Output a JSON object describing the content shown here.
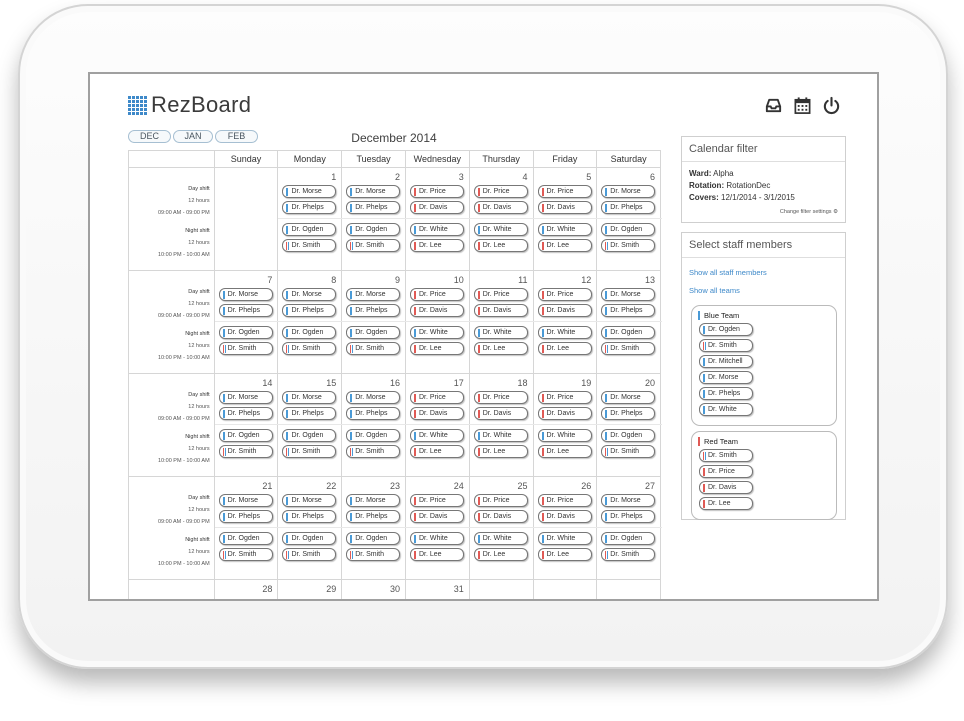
{
  "app": {
    "name": "RezBoard"
  },
  "header_icons": [
    "inbox-icon",
    "calendar-icon",
    "power-icon"
  ],
  "months": [
    "DEC",
    "JAN",
    "FEB"
  ],
  "calendar": {
    "title": "December 2014",
    "day_names": [
      "Sunday",
      "Monday",
      "Tuesday",
      "Wednesday",
      "Thursday",
      "Friday",
      "Saturday"
    ],
    "shift_labels": {
      "day": {
        "name": "Day shift",
        "hours": "12 hours",
        "time": "09:00 AM - 09:00 PM"
      },
      "night": {
        "name": "Night shift",
        "hours": "12 hours",
        "time": "10:00 PM - 10:00 AM"
      }
    },
    "weeks": [
      {
        "days": [
          {
            "num": "",
            "day": [],
            "night": []
          },
          {
            "num": "1",
            "day": [
              "Dr. Morse",
              "Dr. Phelps"
            ],
            "night": [
              "Dr. Ogden",
              "Dr. Smith"
            ]
          },
          {
            "num": "2",
            "day": [
              "Dr. Morse",
              "Dr. Phelps"
            ],
            "night": [
              "Dr. Ogden",
              "Dr. Smith"
            ]
          },
          {
            "num": "3",
            "day": [
              "Dr. Price",
              "Dr. Davis"
            ],
            "night": [
              "Dr. White",
              "Dr. Lee"
            ]
          },
          {
            "num": "4",
            "day": [
              "Dr. Price",
              "Dr. Davis"
            ],
            "night": [
              "Dr. White",
              "Dr. Lee"
            ]
          },
          {
            "num": "5",
            "day": [
              "Dr. Price",
              "Dr. Davis"
            ],
            "night": [
              "Dr. White",
              "Dr. Lee"
            ]
          },
          {
            "num": "6",
            "day": [
              "Dr. Morse",
              "Dr. Phelps"
            ],
            "night": [
              "Dr. Ogden",
              "Dr. Smith"
            ]
          }
        ]
      },
      {
        "days": [
          {
            "num": "7",
            "day": [
              "Dr. Morse",
              "Dr. Phelps"
            ],
            "night": [
              "Dr. Ogden",
              "Dr. Smith"
            ]
          },
          {
            "num": "8",
            "day": [
              "Dr. Morse",
              "Dr. Phelps"
            ],
            "night": [
              "Dr. Ogden",
              "Dr. Smith"
            ]
          },
          {
            "num": "9",
            "day": [
              "Dr. Morse",
              "Dr. Phelps"
            ],
            "night": [
              "Dr. Ogden",
              "Dr. Smith"
            ]
          },
          {
            "num": "10",
            "day": [
              "Dr. Price",
              "Dr. Davis"
            ],
            "night": [
              "Dr. White",
              "Dr. Lee"
            ]
          },
          {
            "num": "11",
            "day": [
              "Dr. Price",
              "Dr. Davis"
            ],
            "night": [
              "Dr. White",
              "Dr. Lee"
            ]
          },
          {
            "num": "12",
            "day": [
              "Dr. Price",
              "Dr. Davis"
            ],
            "night": [
              "Dr. White",
              "Dr. Lee"
            ]
          },
          {
            "num": "13",
            "day": [
              "Dr. Morse",
              "Dr. Phelps"
            ],
            "night": [
              "Dr. Ogden",
              "Dr. Smith"
            ]
          }
        ]
      },
      {
        "days": [
          {
            "num": "14",
            "day": [
              "Dr. Morse",
              "Dr. Phelps"
            ],
            "night": [
              "Dr. Ogden",
              "Dr. Smith"
            ]
          },
          {
            "num": "15",
            "day": [
              "Dr. Morse",
              "Dr. Phelps"
            ],
            "night": [
              "Dr. Ogden",
              "Dr. Smith"
            ]
          },
          {
            "num": "16",
            "day": [
              "Dr. Morse",
              "Dr. Phelps"
            ],
            "night": [
              "Dr. Ogden",
              "Dr. Smith"
            ]
          },
          {
            "num": "17",
            "day": [
              "Dr. Price",
              "Dr. Davis"
            ],
            "night": [
              "Dr. White",
              "Dr. Lee"
            ]
          },
          {
            "num": "18",
            "day": [
              "Dr. Price",
              "Dr. Davis"
            ],
            "night": [
              "Dr. White",
              "Dr. Lee"
            ]
          },
          {
            "num": "19",
            "day": [
              "Dr. Price",
              "Dr. Davis"
            ],
            "night": [
              "Dr. White",
              "Dr. Lee"
            ]
          },
          {
            "num": "20",
            "day": [
              "Dr. Morse",
              "Dr. Phelps"
            ],
            "night": [
              "Dr. Ogden",
              "Dr. Smith"
            ]
          }
        ]
      },
      {
        "days": [
          {
            "num": "21",
            "day": [
              "Dr. Morse",
              "Dr. Phelps"
            ],
            "night": [
              "Dr. Ogden",
              "Dr. Smith"
            ]
          },
          {
            "num": "22",
            "day": [
              "Dr. Morse",
              "Dr. Phelps"
            ],
            "night": [
              "Dr. Ogden",
              "Dr. Smith"
            ]
          },
          {
            "num": "23",
            "day": [
              "Dr. Morse",
              "Dr. Phelps"
            ],
            "night": [
              "Dr. Ogden",
              "Dr. Smith"
            ]
          },
          {
            "num": "24",
            "day": [
              "Dr. Price",
              "Dr. Davis"
            ],
            "night": [
              "Dr. White",
              "Dr. Lee"
            ]
          },
          {
            "num": "25",
            "day": [
              "Dr. Price",
              "Dr. Davis"
            ],
            "night": [
              "Dr. White",
              "Dr. Lee"
            ]
          },
          {
            "num": "26",
            "day": [
              "Dr. Price",
              "Dr. Davis"
            ],
            "night": [
              "Dr. White",
              "Dr. Lee"
            ]
          },
          {
            "num": "27",
            "day": [
              "Dr. Morse",
              "Dr. Phelps"
            ],
            "night": [
              "Dr. Ogden",
              "Dr. Smith"
            ]
          }
        ]
      },
      {
        "days": [
          {
            "num": "28",
            "day": [],
            "night": []
          },
          {
            "num": "29",
            "day": [],
            "night": []
          },
          {
            "num": "30",
            "day": [],
            "night": []
          },
          {
            "num": "31",
            "day": [],
            "night": []
          },
          {
            "num": "",
            "day": [],
            "night": []
          },
          {
            "num": "",
            "day": [],
            "night": []
          },
          {
            "num": "",
            "day": [],
            "night": []
          }
        ]
      }
    ]
  },
  "filter": {
    "title": "Calendar filter",
    "ward_label": "Ward:",
    "ward": "Alpha",
    "rotation_label": "Rotation:",
    "rotation": "RotationDec",
    "covers_label": "Covers:",
    "covers": "12/1/2014 - 3/1/2015",
    "change_link": "Change filter settings"
  },
  "staff": {
    "title": "Select staff members",
    "show_all_staff": "Show all staff members",
    "show_all_teams": "Show all teams",
    "teams": [
      {
        "name": "Blue Team",
        "color": "#4a9ad6",
        "members": [
          "Dr. Ogden",
          "Dr. Smith",
          "Dr. Mitchell",
          "Dr. Morse",
          "Dr. Phelps",
          "Dr. White"
        ]
      },
      {
        "name": "Red Team",
        "color": "#e05a55",
        "members": [
          "Dr. Smith",
          "Dr. Price",
          "Dr. Davis",
          "Dr. Lee"
        ]
      }
    ]
  },
  "colors": {
    "blue_team": "#4a9ad6",
    "red_team": "#e05a55",
    "brand": "#3e89c9"
  }
}
